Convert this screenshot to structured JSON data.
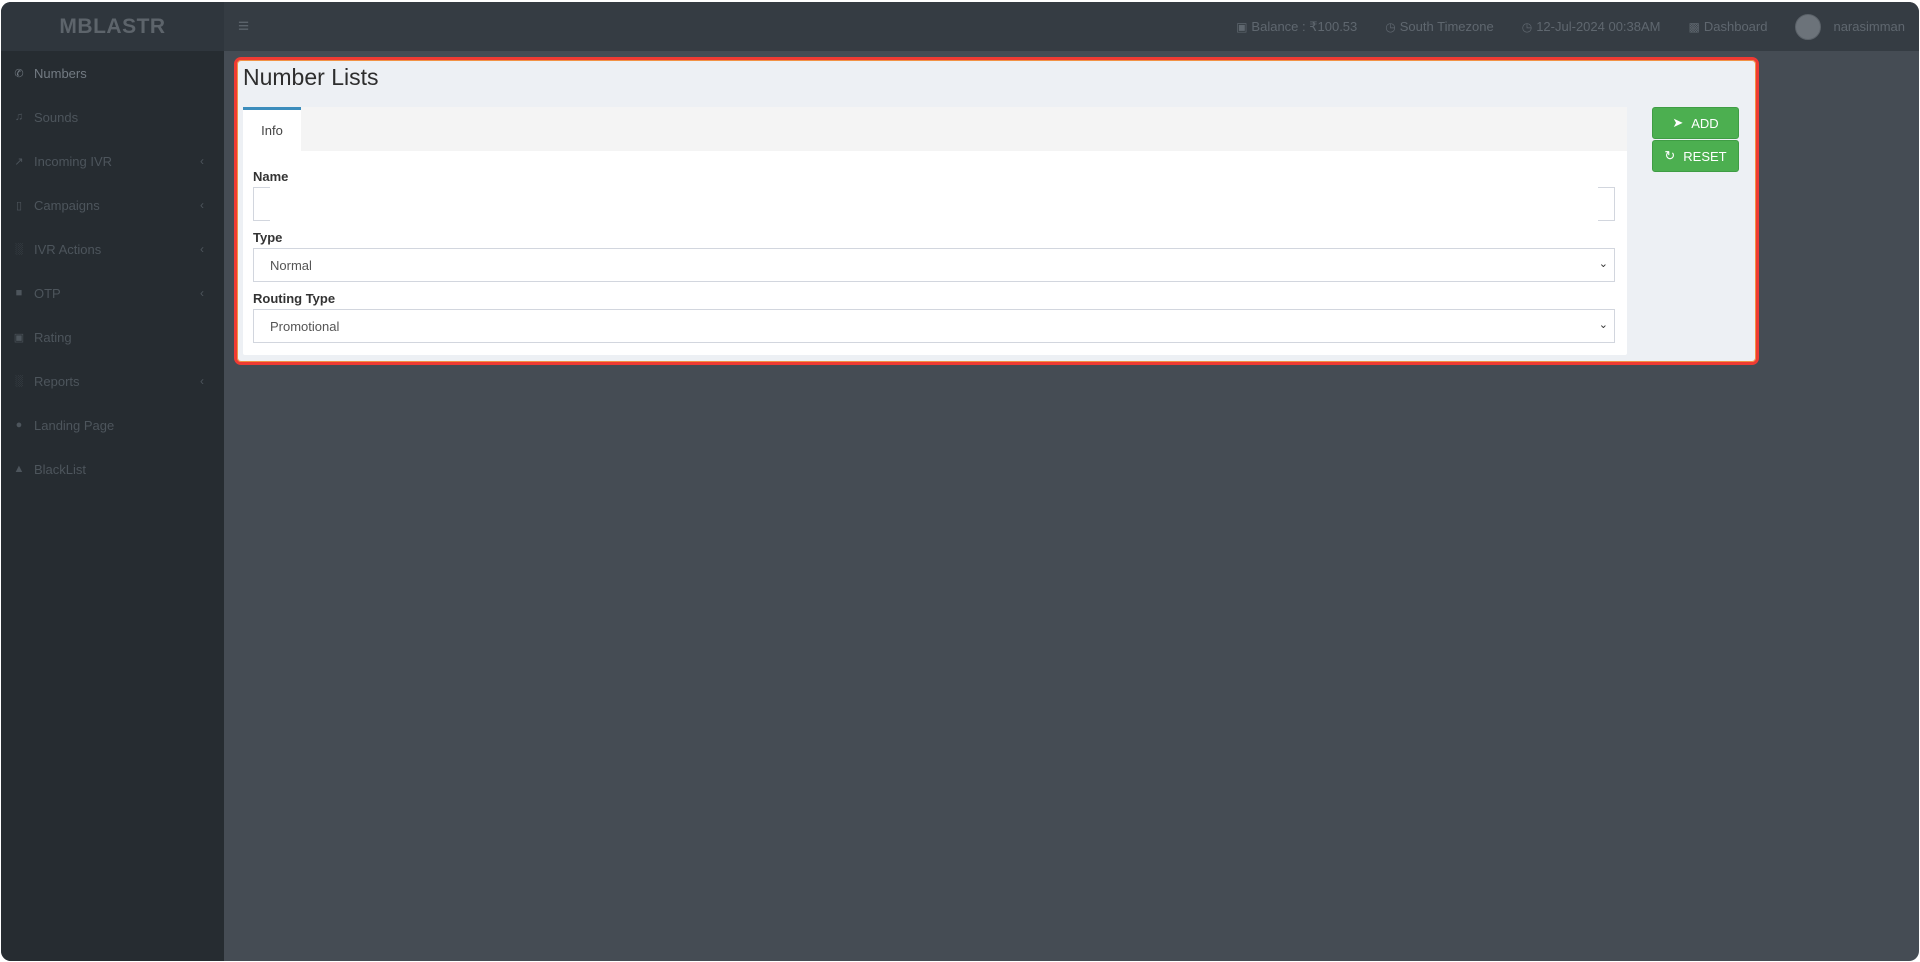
{
  "brand": "MBLASTR",
  "topbar": {
    "hamburger_icon": "menu-icon",
    "balance": "Balance : ₹100.53",
    "timezone": "South Timezone",
    "datetime": "12-Jul-2024 00:38AM",
    "dashboard": "Dashboard",
    "username": "narasimman"
  },
  "sidebar": {
    "items": [
      {
        "label": "Numbers",
        "icon": "phone-icon"
      },
      {
        "label": "Sounds",
        "icon": "music-icon"
      },
      {
        "label": "Incoming IVR",
        "icon": "external-link-icon"
      },
      {
        "label": "Campaigns",
        "icon": "mobile-icon"
      },
      {
        "label": "IVR Actions",
        "icon": "bar-chart-icon"
      },
      {
        "label": "OTP",
        "icon": "unlock-icon"
      },
      {
        "label": "Rating",
        "icon": "money-icon"
      },
      {
        "label": "Reports",
        "icon": "bar-chart-icon"
      },
      {
        "label": "Landing Page",
        "icon": "globe-icon"
      },
      {
        "label": "BlackList",
        "icon": "warning-icon"
      }
    ]
  },
  "page": {
    "title": "Number Lists",
    "tab": "Info",
    "fields": {
      "name_label": "Name",
      "name_value": "",
      "type_label": "Type",
      "type_value": "Normal",
      "routing_label": "Routing Type",
      "routing_value": "Promotional"
    },
    "buttons": {
      "add": "ADD",
      "reset": "RESET"
    }
  }
}
